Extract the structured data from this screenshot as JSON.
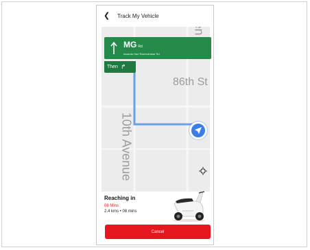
{
  "header": {
    "title": "Track My Vehicle"
  },
  "map": {
    "street_labels": {
      "top_right": "en",
      "cross_street": "86th St",
      "avenue": "10th Avenue"
    }
  },
  "navigation": {
    "road": "MG",
    "road_suffix": "Rd",
    "towards": "towards Hari Ravendrakar Rd",
    "then_label": "Then"
  },
  "eta": {
    "heading": "Reaching in",
    "minutes": "08 Mins",
    "detail": "2.4 kms • 08 mins"
  },
  "actions": {
    "cancel_label": "Cancel"
  },
  "colors": {
    "banner": "#25894a",
    "route": "#6aa0ea",
    "marker": "#3b7fe6",
    "cancel": "#e5161d",
    "eta_red": "#e41b1b"
  },
  "icons": [
    "back-chevron-icon",
    "up-arrow-icon",
    "turn-right-icon",
    "navigation-arrow-icon",
    "recenter-icon"
  ]
}
